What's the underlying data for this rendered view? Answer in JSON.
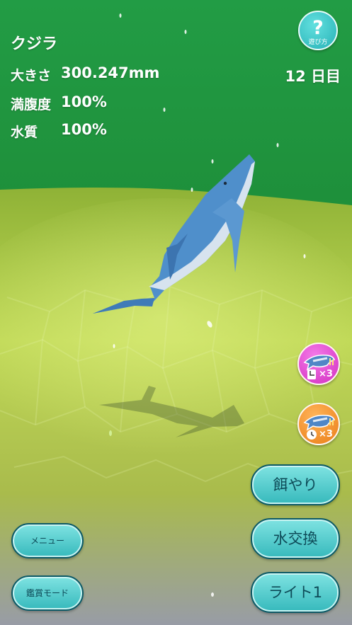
{
  "status": {
    "creature_name": "クジラ",
    "size_label": "大きさ",
    "size_value": "300.247mm",
    "fullness_label": "満腹度",
    "fullness_value": "100%",
    "water_label": "水質",
    "water_value": "100%",
    "day_counter": "12 日目"
  },
  "help": {
    "symbol": "?",
    "label": "遊び方",
    "icon": "question-mark-icon"
  },
  "boosts": [
    {
      "icon": "whale-growth-tap-icon",
      "multiplier": "×3",
      "color": "#e040c8"
    },
    {
      "icon": "whale-growth-time-icon",
      "multiplier": "×3",
      "color": "#f08a24"
    }
  ],
  "buttons": {
    "feed": "餌やり",
    "water_change": "水交換",
    "light": "ライト1",
    "menu": "メニュー",
    "viewing_mode": "鑑賞モード"
  },
  "colors": {
    "sky_top": "#25a046",
    "sky_bottom": "#1d8d38",
    "floor_top": "#9fbe3a",
    "floor_bottom": "#9a9ea2",
    "button_fill": "#52cdcf",
    "button_border": "#0e5a66"
  }
}
